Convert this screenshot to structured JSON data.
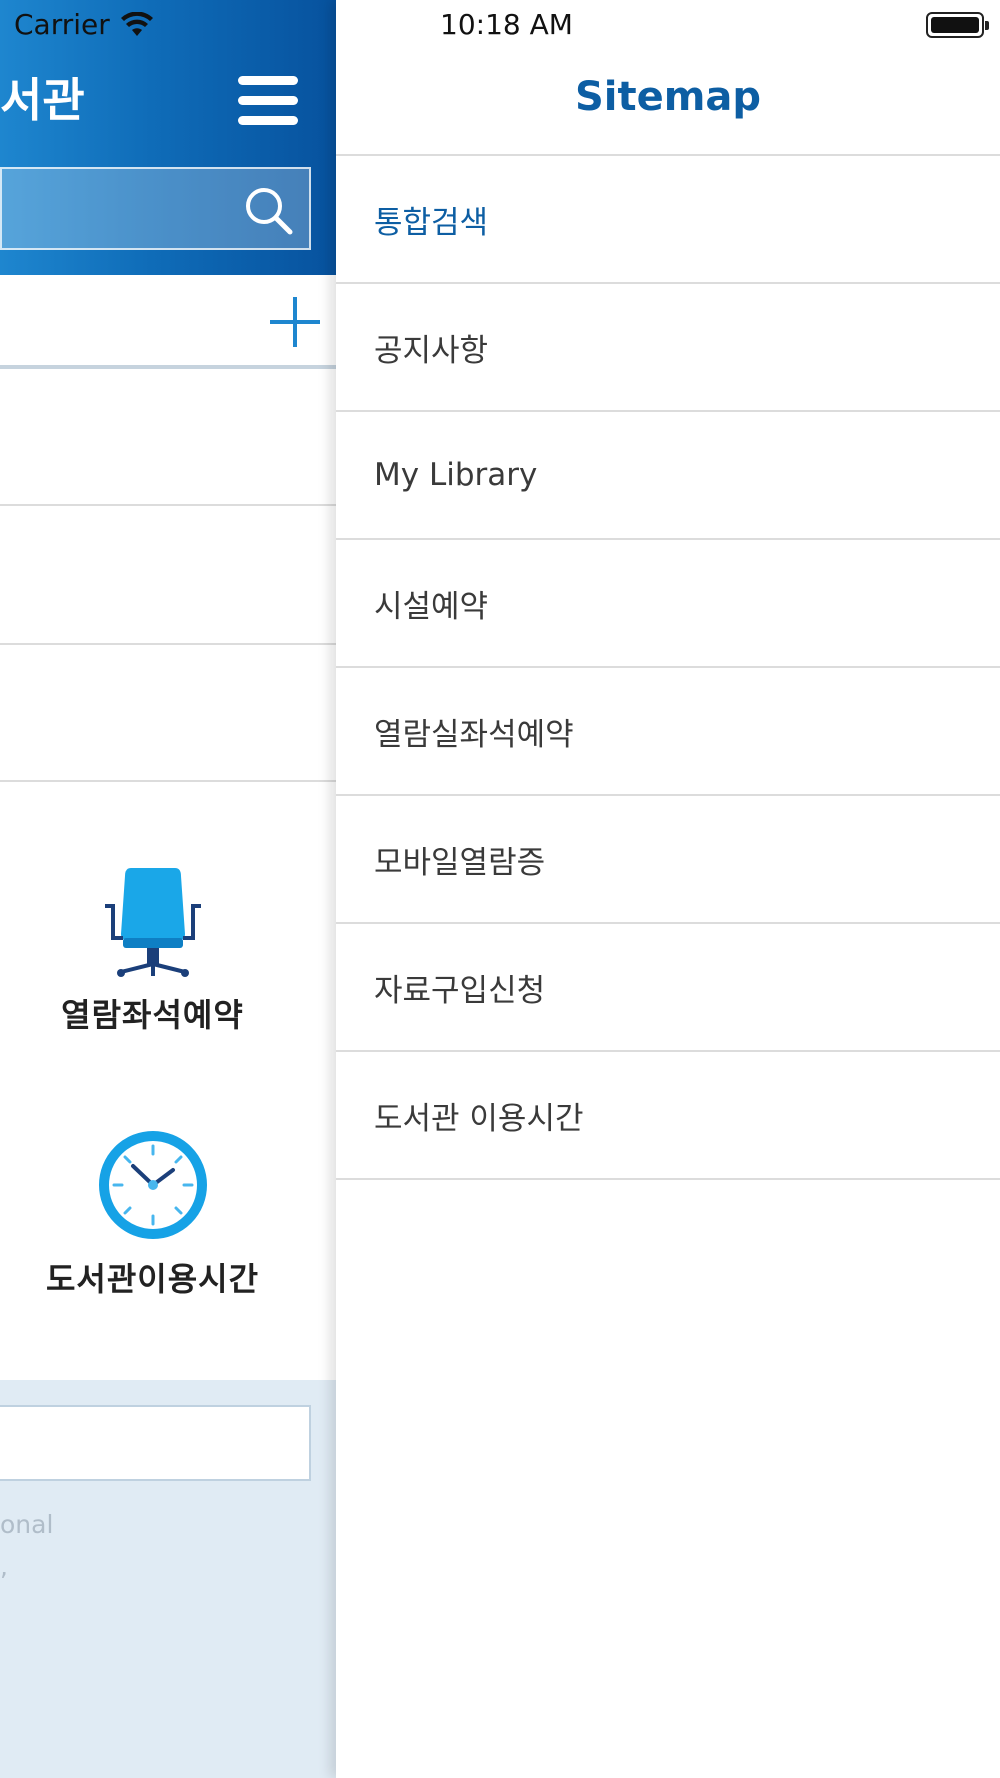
{
  "status_bar": {
    "carrier": "Carrier",
    "time": "10:18 AM"
  },
  "app_header": {
    "title_fragment": "서관",
    "search_placeholder": ""
  },
  "quick_menu": [
    {
      "label": "열람좌석예약",
      "icon": "chair-icon"
    },
    {
      "label": "도서관이용시간",
      "icon": "clock-icon"
    }
  ],
  "footer": {
    "text_fragment": "onal",
    "text_fragment2": ","
  },
  "sitemap": {
    "title": "Sitemap",
    "items": [
      {
        "label": "통합검색",
        "active": true
      },
      {
        "label": "공지사항",
        "active": false
      },
      {
        "label": "My Library",
        "active": false
      },
      {
        "label": "시설예약",
        "active": false
      },
      {
        "label": "열람실좌석예약",
        "active": false
      },
      {
        "label": "모바일열람증",
        "active": false
      },
      {
        "label": "자료구입신청",
        "active": false
      },
      {
        "label": "도서관 이용시간",
        "active": false
      }
    ]
  },
  "colors": {
    "accent": "#0d5ea3",
    "header_gradient_start": "#1e86cf",
    "header_gradient_end": "#07529e",
    "footer_bg": "#e0ebf4"
  }
}
